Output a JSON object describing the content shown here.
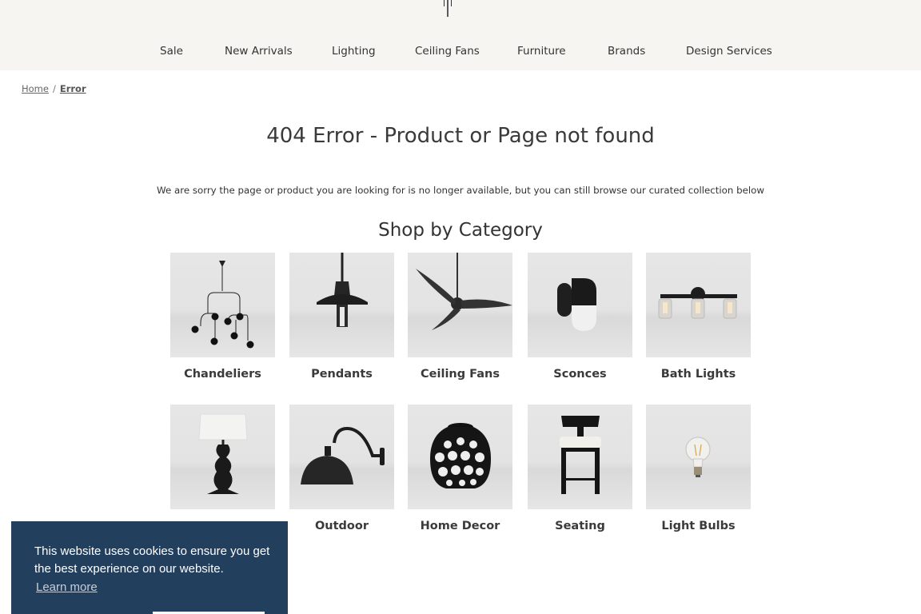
{
  "nav": {
    "items": [
      {
        "label": "Sale"
      },
      {
        "label": "New Arrivals"
      },
      {
        "label": "Lighting"
      },
      {
        "label": "Ceiling Fans"
      },
      {
        "label": "Furniture"
      },
      {
        "label": "Brands"
      },
      {
        "label": "Design Services"
      }
    ]
  },
  "breadcrumb": {
    "home": "Home",
    "separator": "/",
    "current": "Error"
  },
  "page": {
    "title": "404 Error - Product or Page not found",
    "message": "We are sorry the page or product you are looking for is no longer available, but you can still browse our curated collection below",
    "shop_title": "Shop by Category"
  },
  "categories": [
    {
      "label": "Chandeliers",
      "icon": "chandelier-icon"
    },
    {
      "label": "Pendants",
      "icon": "pendant-icon"
    },
    {
      "label": "Ceiling Fans",
      "icon": "ceiling-fan-icon"
    },
    {
      "label": "Sconces",
      "icon": "sconce-icon"
    },
    {
      "label": "Bath Lights",
      "icon": "bath-light-icon"
    },
    {
      "label": "",
      "icon": "table-lamp-icon"
    },
    {
      "label": "Outdoor",
      "icon": "outdoor-light-icon"
    },
    {
      "label": "Home Decor",
      "icon": "vase-icon"
    },
    {
      "label": "Seating",
      "icon": "stool-icon"
    },
    {
      "label": "Light Bulbs",
      "icon": "light-bulb-icon"
    }
  ],
  "cookie": {
    "message": "This website uses cookies to ensure you get the best experience on our website.",
    "learn_more": "Learn more",
    "accept_label": ""
  },
  "colors": {
    "header_bg": "#f6f5f2",
    "cookie_bg": "#233f5e"
  }
}
